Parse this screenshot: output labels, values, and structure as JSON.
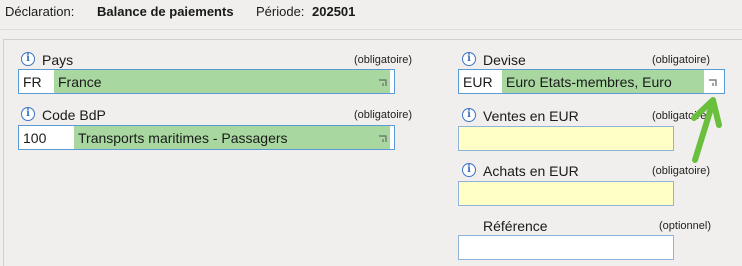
{
  "header": {
    "declaration_label": "Déclaration:",
    "declaration_value": "Balance de paiements",
    "period_label": "Période:",
    "period_value": "202501"
  },
  "fields": {
    "pays": {
      "label": "Pays",
      "requirement": "(obligatoire)",
      "code": "FR",
      "value": "France"
    },
    "code_bdp": {
      "label": "Code BdP",
      "requirement": "(obligatoire)",
      "code": "100",
      "value": "Transports maritimes - Passagers"
    },
    "devise": {
      "label": "Devise",
      "requirement": "(obligatoire)",
      "code": "EUR",
      "value": "Euro Etats-membres, Euro"
    },
    "ventes": {
      "label": "Ventes en EUR",
      "requirement": "(obligatoire)",
      "value": ""
    },
    "achats": {
      "label": "Achats en EUR",
      "requirement": "(obligatoire)",
      "value": ""
    },
    "reference": {
      "label": "Référence",
      "requirement": "(optionnel)",
      "value": ""
    }
  },
  "icons": {
    "info": "info-icon",
    "dropdown": "dropdown-corner-icon",
    "annotation": "green-arrow-icon"
  },
  "colors": {
    "selected_fill": "#a8d8a0",
    "required_empty": "#ffffc6",
    "field_border": "#5b9bd5",
    "info_icon": "#3b72c4",
    "annotation_arrow": "#6abf3c"
  }
}
